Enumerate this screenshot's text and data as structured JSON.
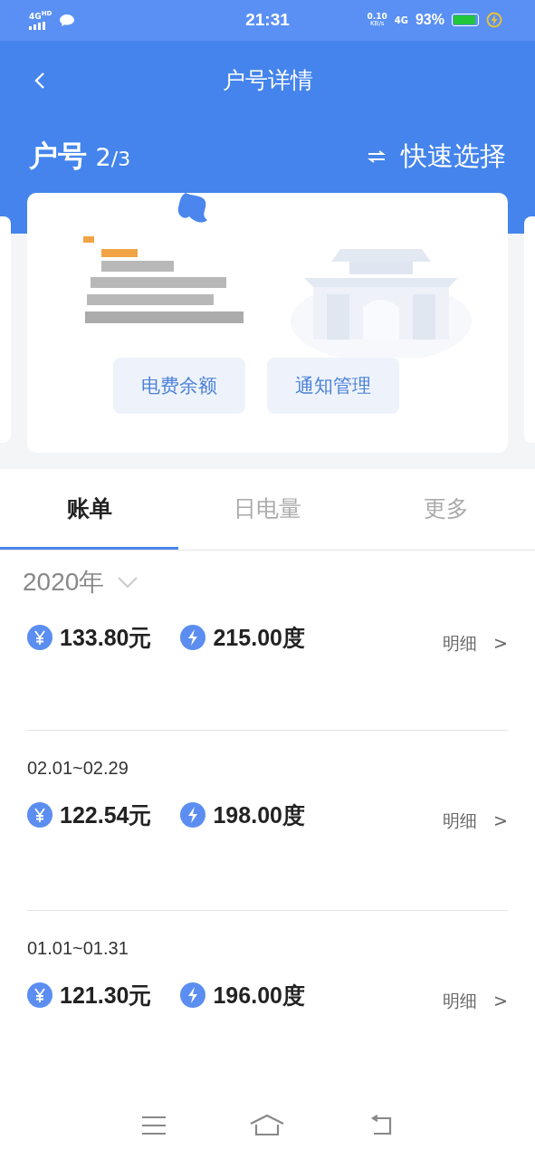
{
  "status_bar": {
    "network": "4G",
    "network_badge": "HD",
    "time": "21:31",
    "speed": "0.10",
    "speed_unit": "KB/s",
    "mobile": "4G",
    "battery_text": "93%",
    "battery": {
      "level": 0.93
    }
  },
  "nav": {
    "title": "户号详情"
  },
  "account": {
    "label": "户号",
    "index": "2",
    "total": "/3",
    "quick_select": "快速选择"
  },
  "card": {
    "buttons": [
      "电费余额",
      "通知管理"
    ]
  },
  "tabs": [
    {
      "label": "账单",
      "selected": true
    },
    {
      "label": "日电量",
      "selected": false
    },
    {
      "label": "更多",
      "selected": false
    }
  ],
  "year": "2020年",
  "bills": [
    {
      "amount": "133.80元",
      "usage": "215.00度",
      "detail": "明细",
      "arrow": ">"
    },
    {
      "period": "02.01~02.29",
      "amount": "122.54元",
      "usage": "198.00度",
      "detail": "明细",
      "arrow": ">"
    },
    {
      "period": "01.01~01.31",
      "amount": "121.30元",
      "usage": "196.00度",
      "detail": "明细",
      "arrow": ">"
    }
  ]
}
